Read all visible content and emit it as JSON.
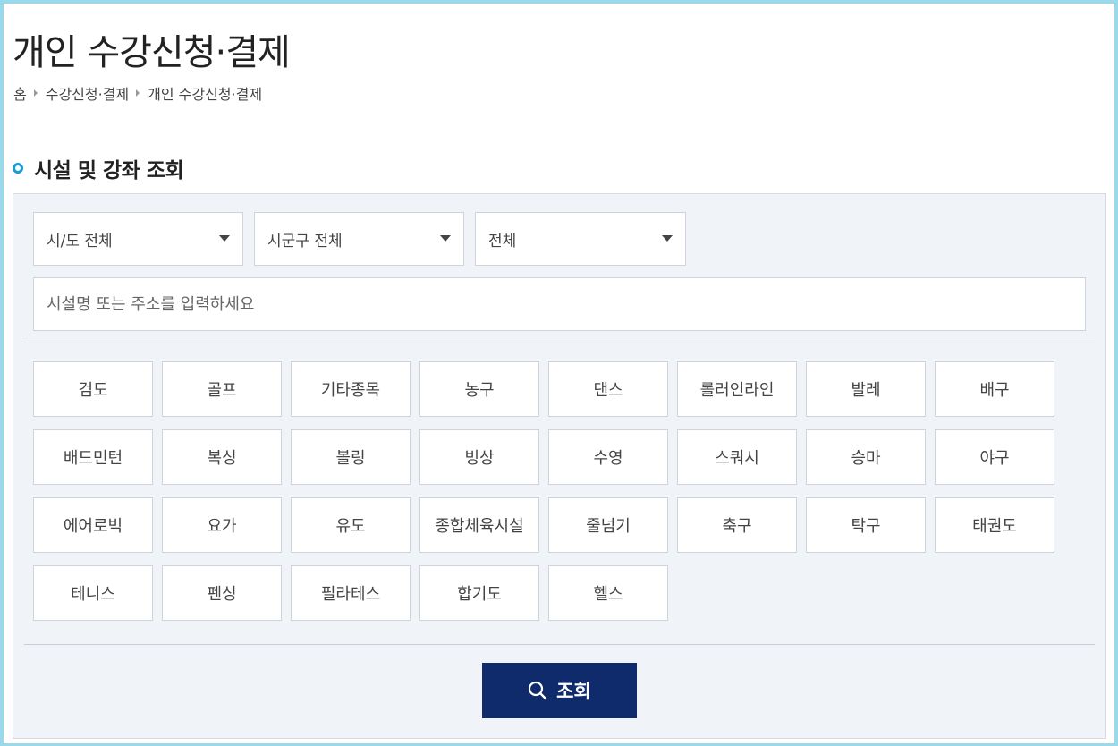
{
  "page": {
    "title": "개인 수강신청·결제"
  },
  "breadcrumb": [
    "홈",
    "수강신청·결제",
    "개인 수강신청·결제"
  ],
  "section": {
    "title": "시설 및 강좌 조회",
    "bullet_color": "#1a9ad6"
  },
  "filters": {
    "region": "시/도 전체",
    "district": "시군구 전체",
    "type": "전체",
    "search_placeholder": "시설명 또는 주소를 입력하세요"
  },
  "sports": [
    "검도",
    "골프",
    "기타종목",
    "농구",
    "댄스",
    "롤러인라인",
    "발레",
    "배구",
    "배드민턴",
    "복싱",
    "볼링",
    "빙상",
    "수영",
    "스쿼시",
    "승마",
    "야구",
    "에어로빅",
    "요가",
    "유도",
    "종합체육시설",
    "줄넘기",
    "축구",
    "탁구",
    "태권도",
    "테니스",
    "펜싱",
    "필라테스",
    "합기도",
    "헬스"
  ],
  "submit": {
    "label": "조회",
    "icon": "search-icon",
    "color": "#0f2b6b"
  }
}
